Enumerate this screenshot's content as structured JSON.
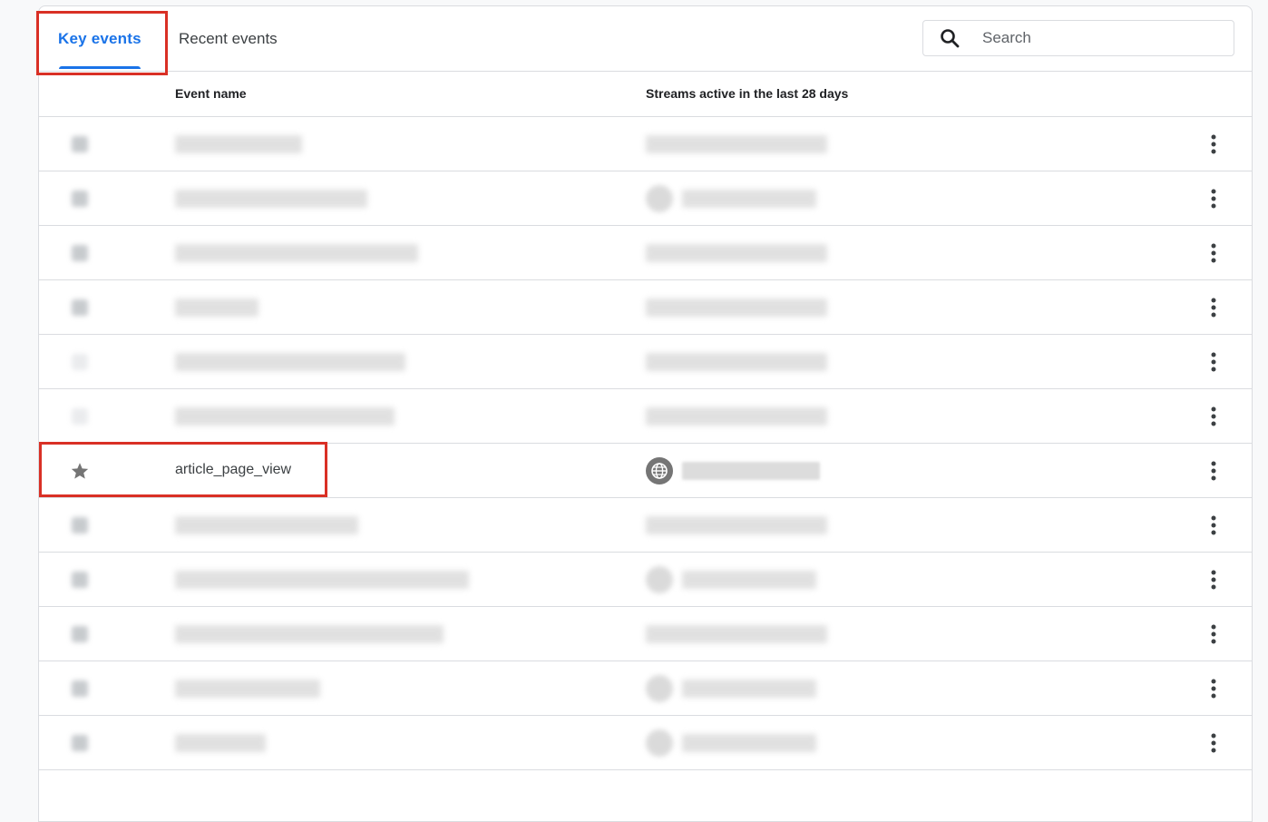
{
  "tabs": {
    "key_events": "Key events",
    "recent_events": "Recent events"
  },
  "search": {
    "placeholder": "Search"
  },
  "table": {
    "headers": {
      "event_name": "Event name",
      "streams": "Streams active in the last 28 days"
    },
    "highlighted_row": {
      "event_name": "article_page_view"
    }
  },
  "icons": {
    "search": "search-icon",
    "star": "star-icon",
    "globe": "globe-icon",
    "more": "more-vert-icon"
  },
  "colors": {
    "accent": "#1a73e8",
    "highlight": "#d93025"
  }
}
